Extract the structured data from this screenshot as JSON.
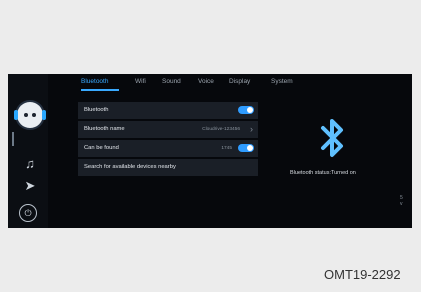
{
  "tabs": [
    "Bluetooth",
    "Wifi",
    "Sound",
    "Voice",
    "Display",
    "System"
  ],
  "settings": {
    "bluetooth_label": "Bluetooth",
    "bluetooth_name_label": "Bluetooth name",
    "bluetooth_name_value": "Cloudrive-123456",
    "can_be_found_label": "Can be found",
    "can_be_found_value": "1745",
    "search_label": "Search for available devices nearby"
  },
  "bluetooth_status": "Bluetooth status:Turned on",
  "side_controls": [
    "5",
    "v"
  ],
  "figure_code": "OMT19-2292",
  "colors": {
    "accent": "#39a9ff",
    "toggle_on": "#2f9cff",
    "background": "#06080c"
  },
  "icons": [
    "robot-avatar-icon",
    "music-note-icon",
    "navigation-arrow-icon",
    "power-icon",
    "bluetooth-icon",
    "chevron-right-icon"
  ]
}
